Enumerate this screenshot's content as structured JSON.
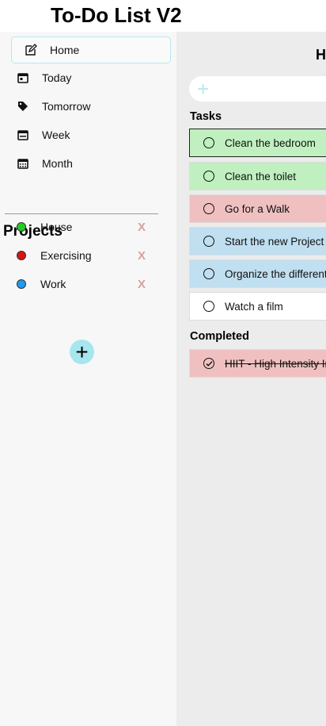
{
  "app": {
    "title": "To-Do List V2"
  },
  "sidebar": {
    "nav": [
      {
        "label": "Home",
        "icon": "edit-icon",
        "active": true
      },
      {
        "label": "Today",
        "icon": "calendar-day-icon"
      },
      {
        "label": "Tomorrow",
        "icon": "tag-icon"
      },
      {
        "label": "Week",
        "icon": "calendar-week-icon"
      },
      {
        "label": "Month",
        "icon": "calendar-month-icon"
      }
    ],
    "projects_title": "Projects",
    "projects": [
      {
        "label": "House",
        "color": "#22cc22",
        "remove": "X"
      },
      {
        "label": "Exercising",
        "color": "#dd1111",
        "remove": "X"
      },
      {
        "label": "Work",
        "color": "#2299ee",
        "remove": "X"
      }
    ],
    "add_project": "+"
  },
  "main": {
    "heading": "H",
    "add_task": "+",
    "tasks_title": "Tasks",
    "tasks": [
      {
        "label": "Clean the bedroom",
        "color": "#c0f0c0"
      },
      {
        "label": "Clean the toilet",
        "color": "#c0f0c0"
      },
      {
        "label": "Go for a Walk",
        "color": "#f0c0c0"
      },
      {
        "label": "Start the new Project",
        "color": "#c0dff0"
      },
      {
        "label": "Organize the different files",
        "color": "#c0dff0"
      },
      {
        "label": "Watch a film",
        "color": "#ffffff"
      }
    ],
    "completed_title": "Completed",
    "completed": [
      {
        "label": "HIIT - High Intensity Interval Training",
        "color": "#f0c0c0"
      }
    ]
  }
}
